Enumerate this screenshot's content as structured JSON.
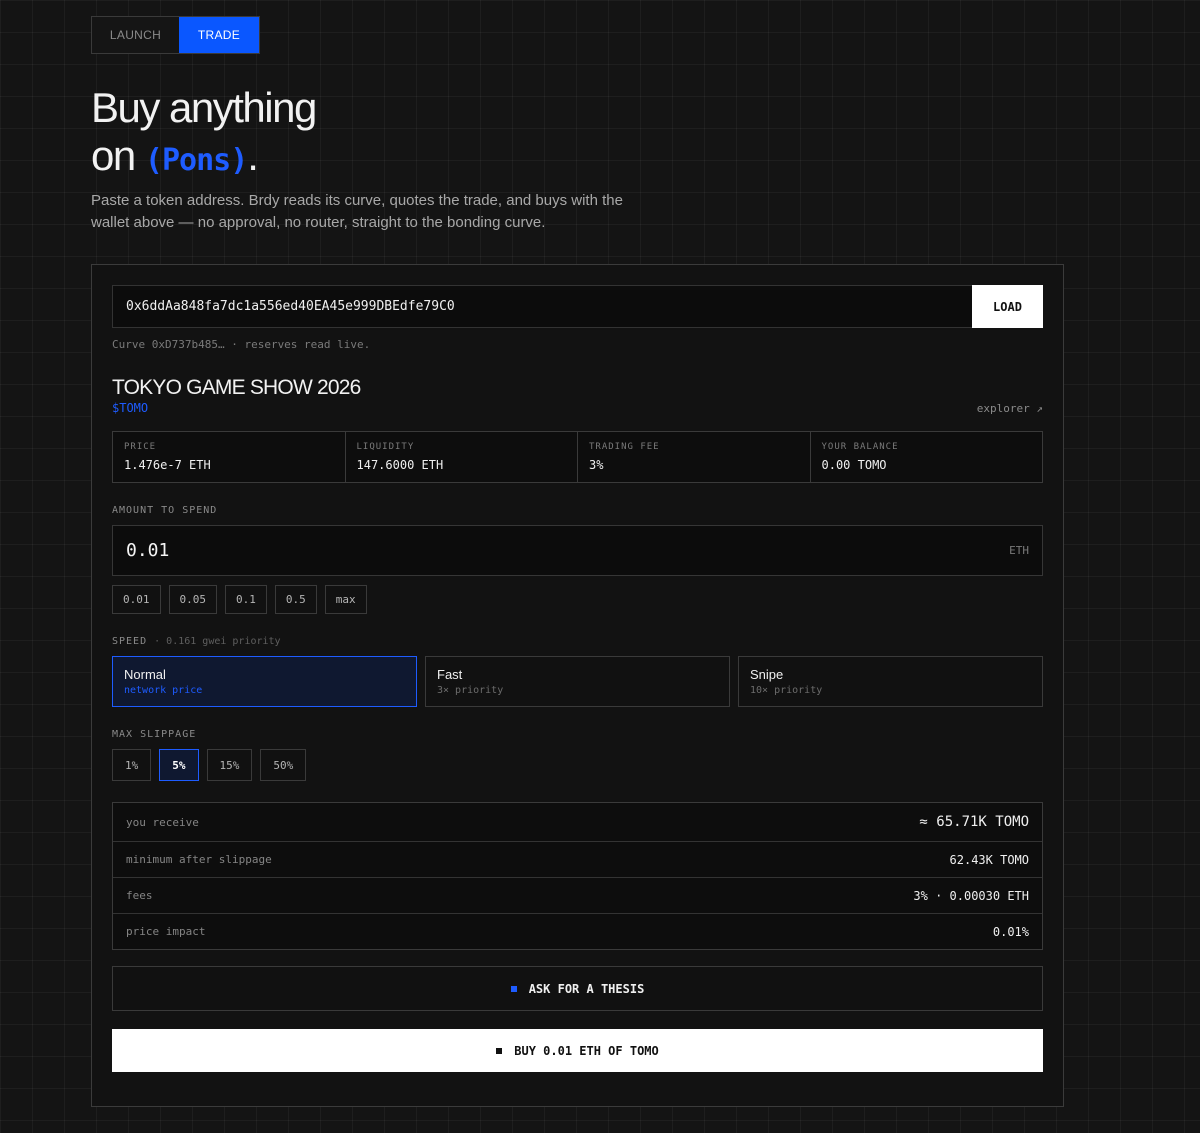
{
  "mode_tabs": {
    "launch": "LAUNCH",
    "trade": "TRADE"
  },
  "hero": {
    "line1": "Buy anything",
    "line2_prefix": "on ",
    "brand": "(Pons)",
    "line2_suffix": ".",
    "subtitle": "Paste a token address. Brdy reads its curve, quotes the trade, and buys with the wallet above — no approval, no router, straight to the bonding curve."
  },
  "address": {
    "value": "0x6ddAa848fa7dc1a556ed40EA45e999DBEdfe79C0",
    "load_label": "LOAD",
    "curve_note": "Curve 0xD737b485… · reserves read live."
  },
  "token": {
    "name": "TOKYO GAME SHOW 2026",
    "symbol": "$TOMO",
    "explorer": "explorer ↗"
  },
  "stats": [
    {
      "label": "PRICE",
      "value": "1.476e-7 ETH"
    },
    {
      "label": "LIQUIDITY",
      "value": "147.6000 ETH"
    },
    {
      "label": "TRADING FEE",
      "value": "3%"
    },
    {
      "label": "YOUR BALANCE",
      "value": "0.00 TOMO"
    }
  ],
  "amount": {
    "label": "AMOUNT TO SPEND",
    "value": "0.01",
    "unit": "ETH",
    "presets": [
      "0.01",
      "0.05",
      "0.1",
      "0.5",
      "max"
    ]
  },
  "speed": {
    "label": "SPEED",
    "hint": "· 0.161 gwei priority",
    "options": [
      {
        "name": "Normal",
        "desc": "network price",
        "active": true
      },
      {
        "name": "Fast",
        "desc": "3× priority",
        "active": false
      },
      {
        "name": "Snipe",
        "desc": "10× priority",
        "active": false
      }
    ]
  },
  "slippage": {
    "label": "MAX SLIPPAGE",
    "options": [
      "1%",
      "5%",
      "15%",
      "50%"
    ],
    "selected": "5%"
  },
  "quote": [
    {
      "label": "you receive",
      "value": "≈ 65.71K TOMO"
    },
    {
      "label": "minimum after slippage",
      "value": "62.43K TOMO"
    },
    {
      "label": "fees",
      "value": "3% · 0.00030 ETH"
    },
    {
      "label": "price impact",
      "value": "0.01%"
    }
  ],
  "actions": {
    "thesis": "ASK FOR A THESIS",
    "buy": "BUY 0.01 ETH OF TOMO"
  },
  "colors": {
    "accent": "#1e5cff",
    "tab_active": "#0a57ff",
    "background": "#141414"
  }
}
